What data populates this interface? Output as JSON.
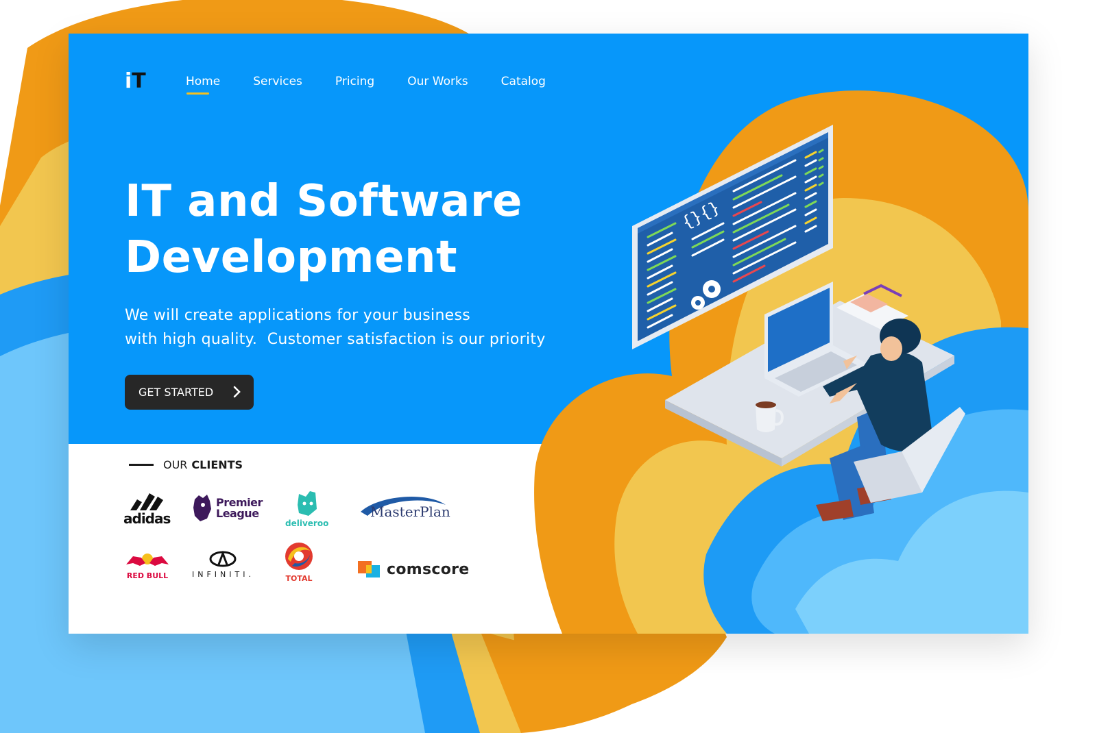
{
  "brand": {
    "logo_i": "i",
    "logo_t": "T"
  },
  "nav": {
    "items": [
      {
        "label": "Home"
      },
      {
        "label": "Services"
      },
      {
        "label": "Pricing"
      },
      {
        "label": "Our Works"
      },
      {
        "label": "Catalog"
      }
    ]
  },
  "hero": {
    "title_line1": "IT and Software",
    "title_line2": "Development",
    "subtitle_line1": "We will create applications for your business",
    "subtitle_line2": "with high quality.  Customer satisfaction is our priority",
    "cta_label": "GET STARTED"
  },
  "clients": {
    "label_prefix": "OUR",
    "label_bold": "CLIENTS",
    "logos": [
      {
        "name": "adidas",
        "text": "adidas"
      },
      {
        "name": "premier-league",
        "text_line1": "Premier",
        "text_line2": "League"
      },
      {
        "name": "deliveroo",
        "text": "deliveroo"
      },
      {
        "name": "masterplan",
        "text": "MasterPlan"
      },
      {
        "name": "red-bull",
        "text": "RED BULL"
      },
      {
        "name": "infiniti",
        "text": "INFINITI."
      },
      {
        "name": "total",
        "text": "TOTAL"
      },
      {
        "name": "comscore",
        "text": "comscore"
      }
    ]
  },
  "colors": {
    "hero_blue": "#0797fa",
    "accent_orange": "#f09a16",
    "accent_yellow": "#f2c64f",
    "light_blue": "#6ec6fb",
    "cta_dark": "#272727",
    "underline_yellow": "#f6c01e"
  },
  "icons": [
    "chevron-right-icon",
    "code-braces-icon",
    "gears-icon",
    "coffee-mug-icon",
    "laptop-icon",
    "developer-figure",
    "office-chair-icon"
  ]
}
